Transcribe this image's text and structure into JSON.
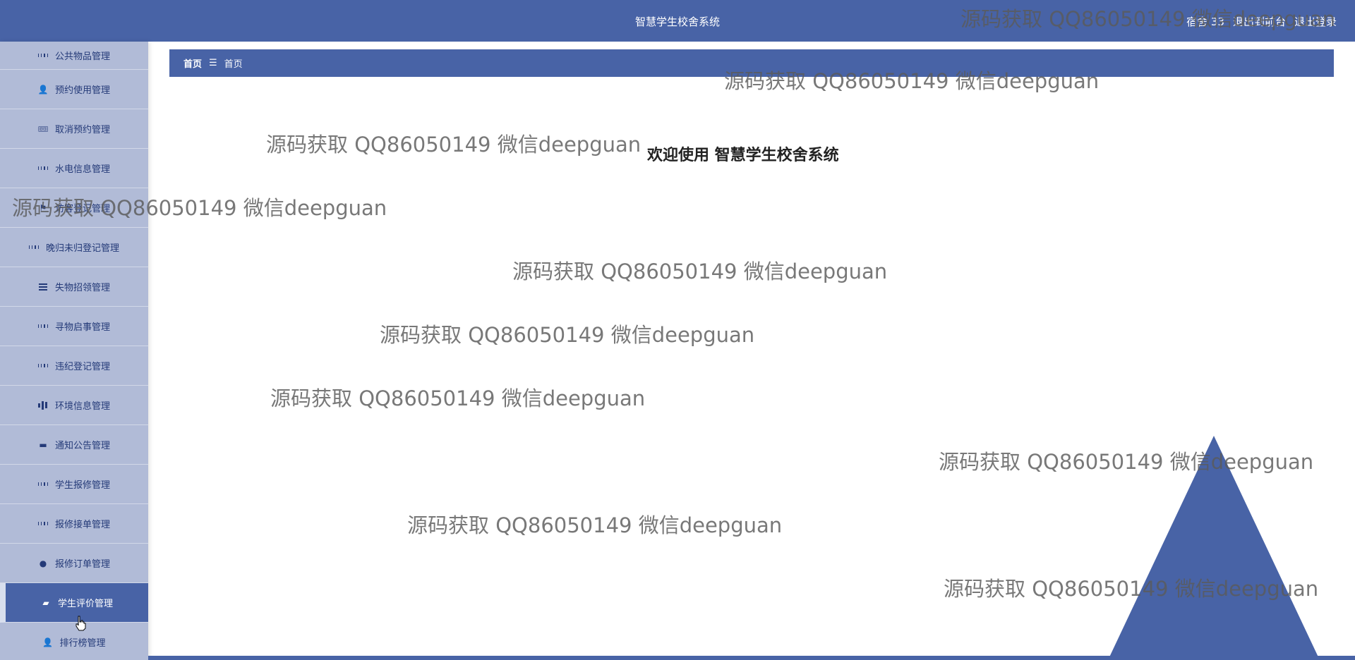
{
  "header": {
    "title": "智慧学生校舍系统",
    "user_label": "宿舍 33",
    "back_to_front": "退出到前台",
    "logout": "退出登录"
  },
  "sidebar": {
    "items": [
      {
        "label": "公共物品管理",
        "icon": "grid-icon"
      },
      {
        "label": "预约使用管理",
        "icon": "user-icon"
      },
      {
        "label": "取消预约管理",
        "icon": "ticket-icon"
      },
      {
        "label": "水电信息管理",
        "icon": "grid-icon"
      },
      {
        "label": "访客登记管理",
        "icon": "flag-icon"
      },
      {
        "label": "晚归未归登记管理",
        "icon": "grid-icon"
      },
      {
        "label": "失物招领管理",
        "icon": "list-icon"
      },
      {
        "label": "寻物启事管理",
        "icon": "grid-icon"
      },
      {
        "label": "违纪登记管理",
        "icon": "grid-icon"
      },
      {
        "label": "环境信息管理",
        "icon": "bar-chart-icon"
      },
      {
        "label": "通知公告管理",
        "icon": "book-icon"
      },
      {
        "label": "学生报修管理",
        "icon": "grid-icon"
      },
      {
        "label": "报修接单管理",
        "icon": "grid-icon"
      },
      {
        "label": "报修订单管理",
        "icon": "balloon-icon"
      },
      {
        "label": "学生评价管理",
        "icon": "comment-icon"
      },
      {
        "label": "排行榜管理",
        "icon": "user-icon"
      }
    ],
    "active_index": 14
  },
  "breadcrumb": {
    "home": "首页",
    "separator": "☰",
    "current": "首页"
  },
  "main": {
    "welcome": "欢迎使用 智慧学生校舍系统"
  },
  "watermark": {
    "text": "源码获取 QQ86050149 微信deepguan"
  },
  "colors": {
    "primary": "#4863a6",
    "sidebar_bg": "#b1bbd7"
  }
}
